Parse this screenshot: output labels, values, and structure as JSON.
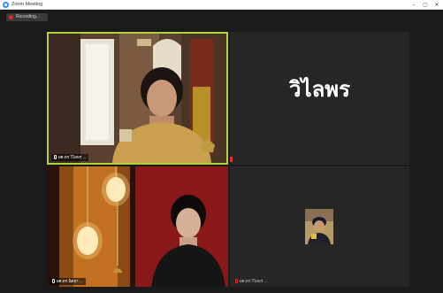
{
  "window": {
    "title": "Zoom Meeting",
    "minimize_glyph": "–",
    "maximize_glyph": "▢",
    "close_glyph": "✕"
  },
  "recording": {
    "label": "Recording...",
    "dot_color": "#e02828"
  },
  "participants": [
    {
      "name": "ผศ.ดร.วิไลพร ...",
      "video": "on",
      "speaking": true
    },
    {
      "name": "วิไลพร",
      "video": "off",
      "display_name_big": "วิไลพร",
      "muted": true
    },
    {
      "name": "ผศ.ดร.นิตยา ...",
      "video": "on"
    },
    {
      "name": "ผศ.ดร.วิไลพร ...",
      "video": "off",
      "avatar": "profile-photo"
    }
  ],
  "colors": {
    "active_speaker_border": "#b4d13c",
    "meeting_background": "#1a1a1a",
    "tile_background": "#262626",
    "muted_indicator": "#e03030"
  }
}
